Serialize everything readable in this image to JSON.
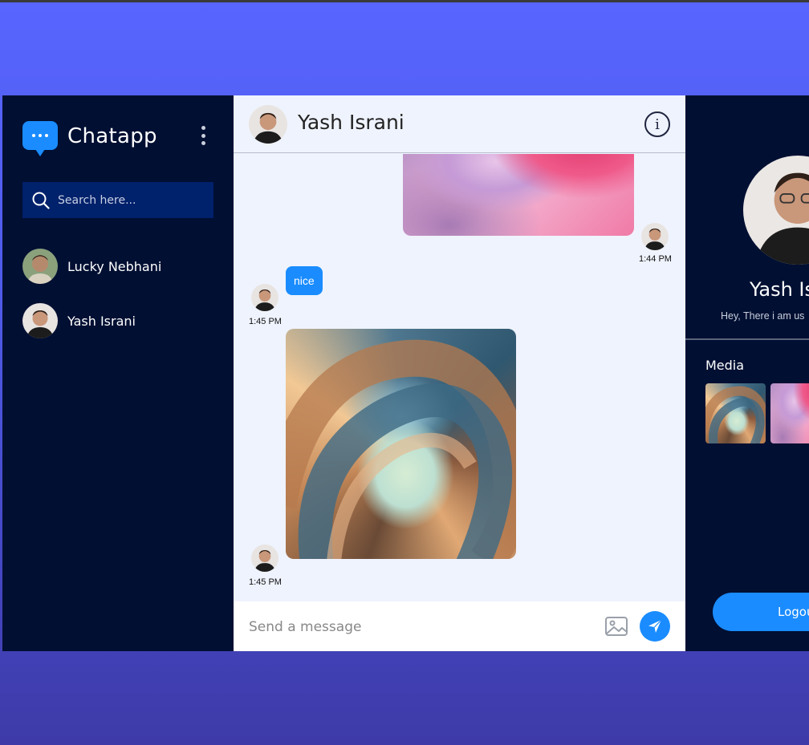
{
  "app": {
    "title": "Chatapp",
    "brand_color": "#1a8cff",
    "sidebar_bg": "#000f32"
  },
  "sidebar": {
    "search_placeholder": "Search here...",
    "contacts": [
      {
        "name": "Lucky Nebhani",
        "avatar": "user-photo"
      },
      {
        "name": "Yash Israni",
        "avatar": "user-photo"
      }
    ]
  },
  "chat": {
    "contact_name": "Yash Israni",
    "messages": [
      {
        "type": "image",
        "time": "1:44 PM"
      },
      {
        "type": "text",
        "text": "nice",
        "time": "1:45 PM"
      },
      {
        "type": "image",
        "time": "1:45 PM"
      }
    ],
    "composer_placeholder": "Send a message"
  },
  "profile": {
    "name": "Yash Is",
    "status": "Hey, There i am us",
    "media_label": "Media",
    "logout_label": "Logou"
  },
  "icons": {
    "logo": "chat-bubble-icon",
    "menu": "kebab-menu-icon",
    "search": "search-icon",
    "info": "info-icon",
    "image": "image-icon",
    "send": "send-icon"
  }
}
